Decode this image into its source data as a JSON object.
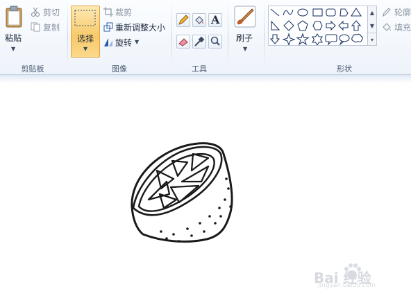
{
  "ribbon": {
    "clipboard": {
      "group_label": "剪贴板",
      "paste_label": "粘贴",
      "cut_label": "剪切",
      "copy_label": "复制"
    },
    "image": {
      "group_label": "图像",
      "select_label": "选择",
      "crop_label": "裁剪",
      "resize_label": "重新调整大小",
      "rotate_label": "旋转"
    },
    "tools": {
      "group_label": "工具",
      "text_tool_glyph": "A"
    },
    "brushes": {
      "label": "刷子"
    },
    "shapes": {
      "group_label": "形状",
      "outline_label": "轮廓",
      "fill_label": "填充"
    }
  },
  "watermark": {
    "text": "Bai 经验",
    "url": "jingyan.baidu.com"
  }
}
